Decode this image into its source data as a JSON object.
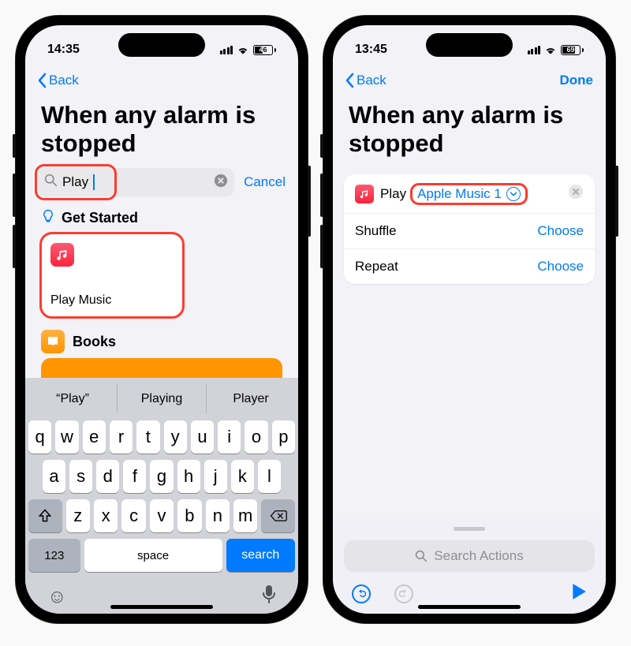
{
  "left": {
    "status": {
      "time": "14:35",
      "battery": "46"
    },
    "nav": {
      "back": "Back"
    },
    "title": "When any alarm is stopped",
    "search": {
      "value": "Play",
      "cancel": "Cancel"
    },
    "get_started": {
      "header": "Get Started",
      "card_label": "Play Music"
    },
    "books": {
      "header": "Books"
    },
    "keyboard": {
      "suggestions": [
        "“Play”",
        "Playing",
        "Player"
      ],
      "row1": [
        "q",
        "w",
        "e",
        "r",
        "t",
        "y",
        "u",
        "i",
        "o",
        "p"
      ],
      "row2": [
        "a",
        "s",
        "d",
        "f",
        "g",
        "h",
        "j",
        "k",
        "l"
      ],
      "row3": [
        "z",
        "x",
        "c",
        "v",
        "b",
        "n",
        "m"
      ],
      "num_key": "123",
      "space": "space",
      "search": "search"
    }
  },
  "right": {
    "status": {
      "time": "13:45",
      "battery": "69"
    },
    "nav": {
      "back": "Back",
      "done": "Done"
    },
    "title": "When any alarm is stopped",
    "action": {
      "prefix": "Play",
      "param": "Apple Music 1",
      "rows": [
        {
          "label": "Shuffle",
          "value": "Choose"
        },
        {
          "label": "Repeat",
          "value": "Choose"
        }
      ]
    },
    "bottom": {
      "search_placeholder": "Search Actions"
    }
  }
}
